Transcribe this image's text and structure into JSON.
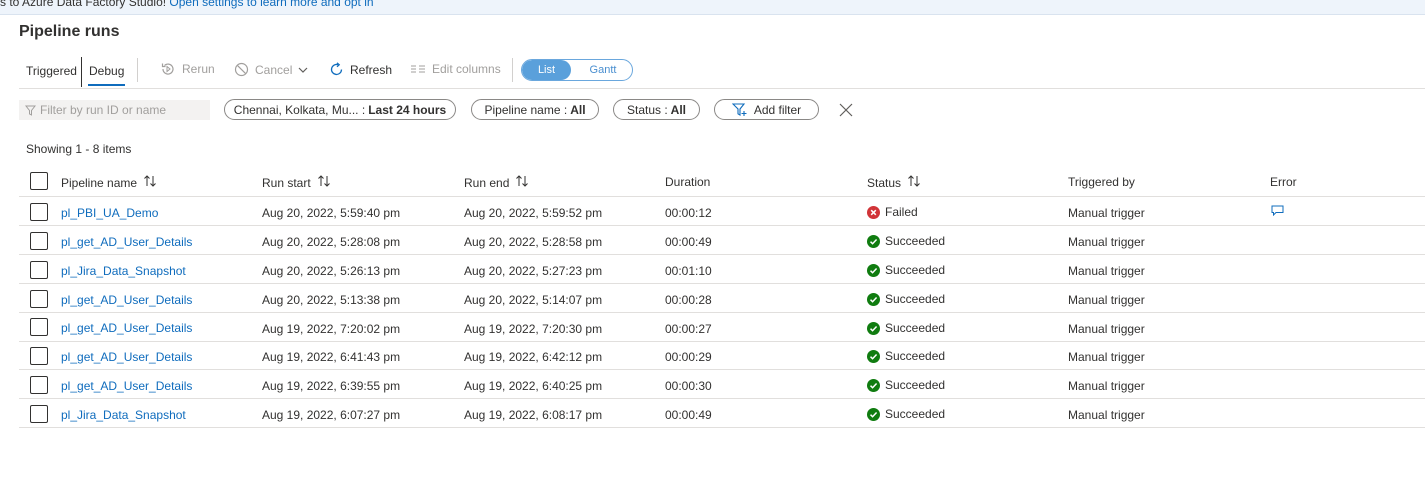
{
  "banner": {
    "text": "s to Azure Data Factory Studio!",
    "link": "Open settings to learn more and opt in"
  },
  "page": {
    "title": "Pipeline runs"
  },
  "tabs": {
    "triggered": "Triggered",
    "debug": "Debug",
    "active": "Debug"
  },
  "toolbar": {
    "rerun": "Rerun",
    "cancel": "Cancel",
    "refresh": "Refresh",
    "edit_columns": "Edit columns",
    "view_toggle": {
      "list": "List",
      "gantt": "Gantt",
      "selected": "List"
    }
  },
  "filters": {
    "search_placeholder": "Filter by run ID or name",
    "timezone": {
      "label": "Chennai, Kolkata, Mu... :",
      "value": "Last 24 hours"
    },
    "pipeline_name": {
      "label": "Pipeline name :",
      "value": "All"
    },
    "status": {
      "label": "Status :",
      "value": "All"
    },
    "add_filter": "Add filter"
  },
  "summary": {
    "showing": "Showing 1 - 8 items"
  },
  "table": {
    "columns": {
      "pipeline_name": "Pipeline name",
      "run_start": "Run start",
      "run_end": "Run end",
      "duration": "Duration",
      "status": "Status",
      "triggered_by": "Triggered by",
      "error": "Error"
    },
    "rows": [
      {
        "pipeline_name": "pl_PBI_UA_Demo",
        "run_start": "Aug 20, 2022, 5:59:40 pm",
        "run_end": "Aug 20, 2022, 5:59:52 pm",
        "duration": "00:00:12",
        "status": "Failed",
        "triggered_by": "Manual trigger",
        "has_error": true
      },
      {
        "pipeline_name": "pl_get_AD_User_Details",
        "run_start": "Aug 20, 2022, 5:28:08 pm",
        "run_end": "Aug 20, 2022, 5:28:58 pm",
        "duration": "00:00:49",
        "status": "Succeeded",
        "triggered_by": "Manual trigger",
        "has_error": false
      },
      {
        "pipeline_name": "pl_Jira_Data_Snapshot",
        "run_start": "Aug 20, 2022, 5:26:13 pm",
        "run_end": "Aug 20, 2022, 5:27:23 pm",
        "duration": "00:01:10",
        "status": "Succeeded",
        "triggered_by": "Manual trigger",
        "has_error": false
      },
      {
        "pipeline_name": "pl_get_AD_User_Details",
        "run_start": "Aug 20, 2022, 5:13:38 pm",
        "run_end": "Aug 20, 2022, 5:14:07 pm",
        "duration": "00:00:28",
        "status": "Succeeded",
        "triggered_by": "Manual trigger",
        "has_error": false
      },
      {
        "pipeline_name": "pl_get_AD_User_Details",
        "run_start": "Aug 19, 2022, 7:20:02 pm",
        "run_end": "Aug 19, 2022, 7:20:30 pm",
        "duration": "00:00:27",
        "status": "Succeeded",
        "triggered_by": "Manual trigger",
        "has_error": false
      },
      {
        "pipeline_name": "pl_get_AD_User_Details",
        "run_start": "Aug 19, 2022, 6:41:43 pm",
        "run_end": "Aug 19, 2022, 6:42:12 pm",
        "duration": "00:00:29",
        "status": "Succeeded",
        "triggered_by": "Manual trigger",
        "has_error": false
      },
      {
        "pipeline_name": "pl_get_AD_User_Details",
        "run_start": "Aug 19, 2022, 6:39:55 pm",
        "run_end": "Aug 19, 2022, 6:40:25 pm",
        "duration": "00:00:30",
        "status": "Succeeded",
        "triggered_by": "Manual trigger",
        "has_error": false
      },
      {
        "pipeline_name": "pl_Jira_Data_Snapshot",
        "run_start": "Aug 19, 2022, 6:07:27 pm",
        "run_end": "Aug 19, 2022, 6:08:17 pm",
        "duration": "00:00:49",
        "status": "Succeeded",
        "triggered_by": "Manual trigger",
        "has_error": false
      }
    ]
  },
  "colors": {
    "accent": "#0f6cbd",
    "success": "#107c10",
    "failed": "#d13438",
    "toggle_active": "#5aa0db"
  },
  "icons": {
    "rerun": "rerun-icon",
    "cancel": "cancel-icon",
    "refresh": "refresh-icon",
    "edit_columns": "edit-columns-icon",
    "filter": "filter-icon",
    "add_filter": "add-filter-icon",
    "clear": "close-icon",
    "sort": "sort-icon",
    "success": "success-check-icon",
    "failed": "failed-x-icon",
    "error_detail": "message-icon"
  }
}
